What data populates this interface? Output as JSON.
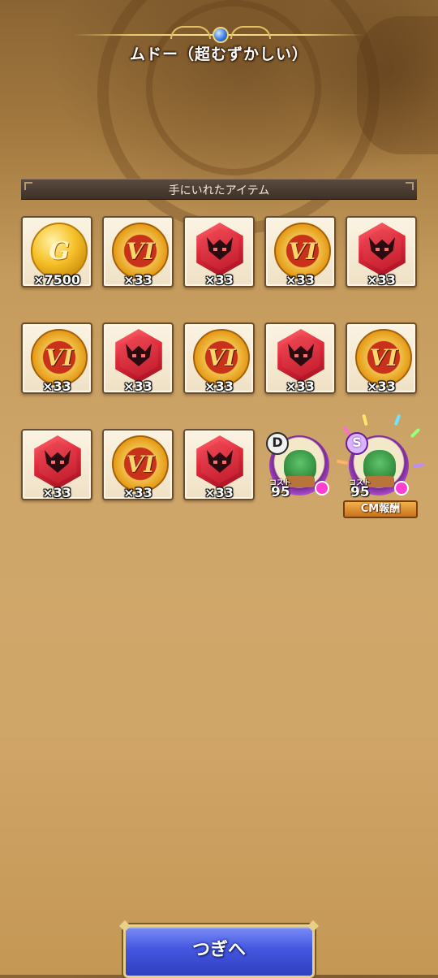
{
  "header": {
    "title": "ムドー（超むずかしい）"
  },
  "section": {
    "label": "手にいれたアイテム"
  },
  "items": [
    {
      "kind": "gold",
      "glyph": "G",
      "qty": "×7500"
    },
    {
      "kind": "vi-coin",
      "glyph": "VI",
      "qty": "×33"
    },
    {
      "kind": "red-crest",
      "qty": "×33"
    },
    {
      "kind": "vi-coin",
      "glyph": "VI",
      "qty": "×33"
    },
    {
      "kind": "red-crest",
      "qty": "×33"
    },
    {
      "kind": "vi-coin",
      "glyph": "VI",
      "qty": "×33"
    },
    {
      "kind": "red-crest",
      "qty": "×33"
    },
    {
      "kind": "vi-coin",
      "glyph": "VI",
      "qty": "×33"
    },
    {
      "kind": "red-crest",
      "qty": "×33"
    },
    {
      "kind": "vi-coin",
      "glyph": "VI",
      "qty": "×33"
    },
    {
      "kind": "red-crest",
      "qty": "×33"
    },
    {
      "kind": "vi-coin",
      "glyph": "VI",
      "qty": "×33"
    },
    {
      "kind": "red-crest",
      "qty": "×33"
    }
  ],
  "monsters": [
    {
      "rank": "D",
      "cost_label": "コスト",
      "cost": "95"
    },
    {
      "rank": "S",
      "cost_label": "コスト",
      "cost": "95",
      "badge": "CM報酬"
    }
  ],
  "footer": {
    "next_label": "つぎへ"
  }
}
